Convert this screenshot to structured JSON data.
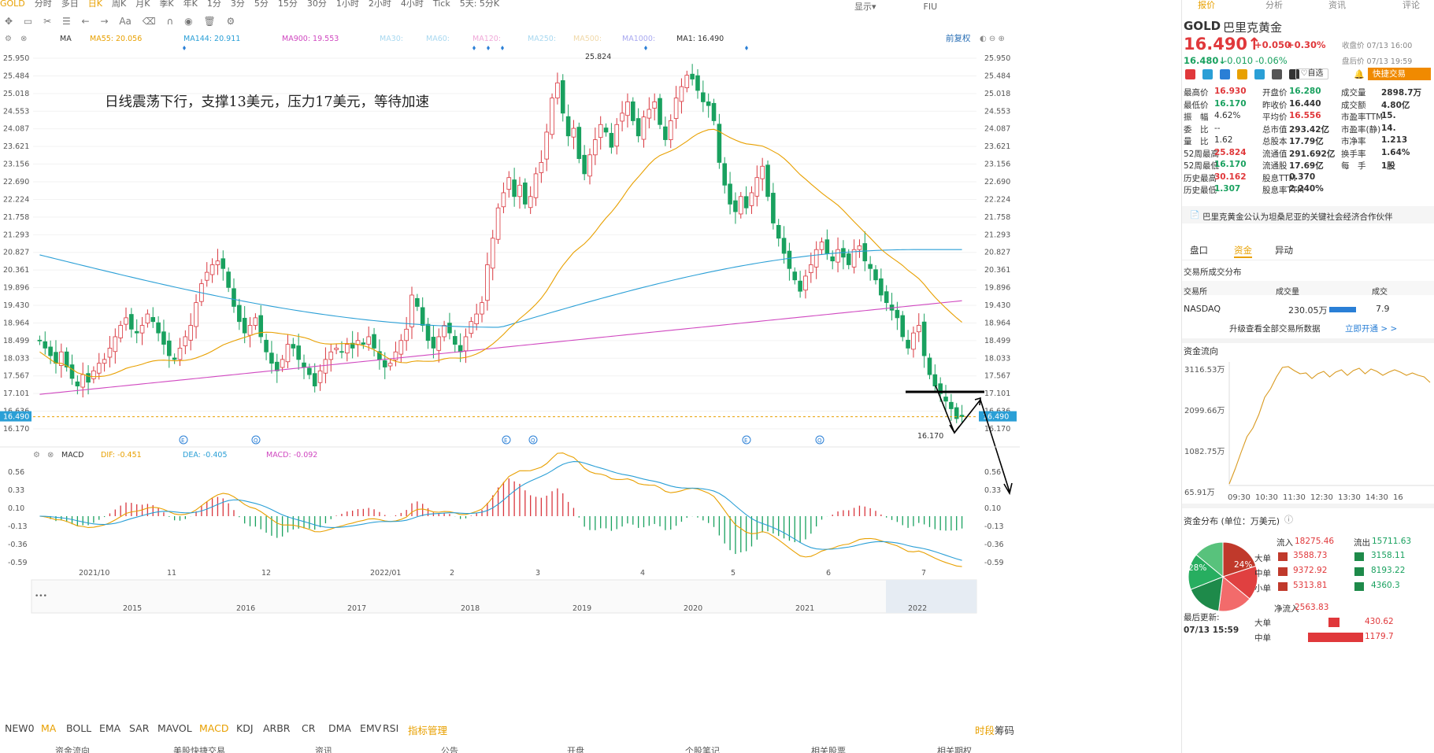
{
  "app": {
    "symbol_tab": "GOLD"
  },
  "topbar": [
    "GOLD",
    "分时",
    "多日",
    "日K",
    "周K",
    "月K",
    "季K",
    "年K",
    "1分",
    "3分",
    "5分",
    "15分",
    "30分",
    "1小时",
    "2小时",
    "4小时",
    "Tick",
    "5天: 5分K"
  ],
  "topbar_active": 3,
  "topbar_right": [
    "显示▾",
    "FIU"
  ],
  "annotation": "日线震荡下行，支撑13美元，压力17美元，等待加速",
  "ma_legend": [
    {
      "label": "MA",
      "color": "#333"
    },
    {
      "label": "MA55: 20.056",
      "color": "#e8a000"
    },
    {
      "label": "MA144: 20.911",
      "color": "#2a9fd6"
    },
    {
      "label": "MA900: 19.553",
      "color": "#d048c0"
    },
    {
      "label": "MA30:",
      "color": "#a8d8f0"
    },
    {
      "label": "MA60:",
      "color": "#a8d8f0"
    },
    {
      "label": "MA120:",
      "color": "#f0a8d8"
    },
    {
      "label": "MA250:",
      "color": "#a8d8f0"
    },
    {
      "label": "MA500:",
      "color": "#f0d8a8"
    },
    {
      "label": "MA1000:",
      "color": "#a8a8f0"
    },
    {
      "label": "MA1: 16.490",
      "color": "#333"
    }
  ],
  "fuquan": "前复权",
  "macd_legend": [
    {
      "label": "MACD",
      "color": "#333"
    },
    {
      "label": "DIF: -0.451",
      "color": "#e8a000"
    },
    {
      "label": "DEA: -0.405",
      "color": "#2a9fd6"
    },
    {
      "label": "MACD: -0.092",
      "color": "#d048c0"
    }
  ],
  "price_ticks": [
    "25.950",
    "25.484",
    "25.018",
    "24.553",
    "24.087",
    "23.621",
    "23.156",
    "22.690",
    "22.224",
    "21.758",
    "21.293",
    "20.827",
    "20.361",
    "19.896",
    "19.430",
    "18.964",
    "18.499",
    "18.033",
    "17.567",
    "17.101",
    "16.636",
    "16.170"
  ],
  "macd_ticks": [
    "0.56",
    "0.33",
    "0.10",
    "-0.13",
    "-0.36",
    "-0.59"
  ],
  "current_price_label": "16.490",
  "high_label": "25.824",
  "low_label": "16.170",
  "month_labels": [
    "2021/10",
    "11",
    "12",
    "2022/01",
    "2",
    "3",
    "4",
    "5",
    "6",
    "7"
  ],
  "year_labels": [
    "2015",
    "2016",
    "2017",
    "2018",
    "2019",
    "2020",
    "2021",
    "2022"
  ],
  "indicators": [
    "NEW0",
    "MA",
    "BOLL",
    "EMA",
    "SAR",
    "MAVOL",
    "MACD",
    "KDJ",
    "ARBR",
    "CR",
    "DMA",
    "EMV",
    "RSI",
    "指标管理"
  ],
  "indicators_active": [
    1,
    6
  ],
  "indicators_right": [
    "时段",
    "筹码"
  ],
  "bottom_tabs": [
    "资金流向",
    "美股快捷交易",
    "资讯",
    "公告",
    "开盘",
    "个股笔记",
    "相关股票",
    "相关期权"
  ],
  "right": {
    "tabs": [
      "报价",
      "分析",
      "资讯",
      "评论"
    ],
    "ticker": "GOLD",
    "name": "巴里克黄金",
    "price": "16.490↑",
    "change": "+0.050",
    "change_pct": "+0.30%",
    "close_note": "收盘价 07/13 16:00",
    "after_price": "16.480↓",
    "after_change": "-0.010",
    "after_pct": "-0.06%",
    "after_note": "盘后价 07/13 19:59",
    "watch": "自选",
    "fast_trade": "快捷交易",
    "stats": [
      [
        "最高价",
        "16.930",
        "red",
        "开盘价",
        "16.280",
        "green",
        "成交量",
        "2898.7万",
        ""
      ],
      [
        "最低价",
        "16.170",
        "green",
        "昨收价",
        "16.440",
        "",
        "成交额",
        "4.80亿",
        ""
      ],
      [
        "振　幅",
        "4.62%",
        "",
        "平均价",
        "16.556",
        "red",
        "市盈率TTM",
        "15.",
        ""
      ],
      [
        "委　比",
        "--",
        "",
        "总市值",
        "293.42亿",
        "",
        "市盈率(静)",
        "14.",
        ""
      ],
      [
        "量　比",
        "1.62",
        "",
        "总股本",
        "17.79亿",
        "",
        "市净率",
        "1.213",
        ""
      ],
      [
        "52周最高",
        "25.824",
        "red",
        "流通值",
        "291.692亿",
        "",
        "换手率",
        "1.64%",
        ""
      ],
      [
        "52周最低",
        "16.170",
        "green",
        "流通股",
        "17.69亿",
        "",
        "每　手",
        "1股",
        ""
      ],
      [
        "历史最高",
        "30.162",
        "red",
        "股息TTM",
        "0.370",
        "",
        "",
        "",
        ""
      ],
      [
        "历史最低",
        "1.307",
        "green",
        "股息率TTM",
        "2.240%",
        "",
        "",
        "",
        ""
      ]
    ],
    "news": "巴里克黄金公认为坦桑尼亚的关键社会经济合作伙伴",
    "sub_tabs": [
      "盘口",
      "资金",
      "异动"
    ],
    "exch_title": "交易所成交分布",
    "exch_head": [
      "交易所",
      "成交量",
      "成交"
    ],
    "exch_row": [
      "NASDAQ",
      "230.05万",
      "7.9"
    ],
    "upgrade": "升级查看全部交易所数据",
    "upgrade_link": "立即开通 > >",
    "flow_title": "资金流向",
    "flow_ticks": [
      "3116.53万",
      "2099.66万",
      "1082.75万",
      "65.91万"
    ],
    "flow_times": [
      "09:30",
      "10:30",
      "11:30",
      "12:30",
      "13:30",
      "14:30",
      "16"
    ],
    "dist_title": "资金分布 (单位：万美元)",
    "pie_in_pct": "28%",
    "pie_out_pct": "24%",
    "inflow_label": "流入",
    "inflow": "18275.46",
    "outflow_label": "流出",
    "outflow": "15711.63",
    "rows": [
      {
        "label": "大单",
        "in": "3588.73",
        "out": "3158.11"
      },
      {
        "label": "中单",
        "in": "9372.92",
        "out": "8193.22"
      },
      {
        "label": "小单",
        "in": "5313.81",
        "out": "4360.3"
      }
    ],
    "last_update_label": "最后更新:",
    "last_update": "07/13 15:59",
    "net_label": "净流入",
    "net": "2563.83",
    "net_rows": [
      {
        "label": "大单",
        "value": "430.62"
      },
      {
        "label": "中单",
        "value": "1179.7"
      }
    ]
  },
  "chart_data": {
    "type": "candlestick",
    "title": "GOLD 日K",
    "y_range": [
      16.17,
      25.95
    ],
    "macd_range": [
      -0.59,
      0.56
    ],
    "closes": [
      18.5,
      18.3,
      18.1,
      17.9,
      18.2,
      17.8,
      17.5,
      17.3,
      17.6,
      17.4,
      17.7,
      17.9,
      18.0,
      18.3,
      18.6,
      18.9,
      19.1,
      18.8,
      18.7,
      18.9,
      19.2,
      19.0,
      18.7,
      18.4,
      18.1,
      18.0,
      18.3,
      18.6,
      18.9,
      19.5,
      20.0,
      20.3,
      20.5,
      20.6,
      20.4,
      19.9,
      19.4,
      19.0,
      18.7,
      18.9,
      19.1,
      18.6,
      18.2,
      17.9,
      17.7,
      18.0,
      18.4,
      18.3,
      18.0,
      17.8,
      17.6,
      17.3,
      17.7,
      18.0,
      18.2,
      18.3,
      18.2,
      18.4,
      18.3,
      18.5,
      18.4,
      18.6,
      18.3,
      18.0,
      17.8,
      17.9,
      18.2,
      18.5,
      18.8,
      19.7,
      19.4,
      18.9,
      18.5,
      18.3,
      18.6,
      18.9,
      18.7,
      18.4,
      18.2,
      18.6,
      19.0,
      19.2,
      19.5,
      20.5,
      21.2,
      22.0,
      22.4,
      22.8,
      22.3,
      22.6,
      22.1,
      22.3,
      22.9,
      23.2,
      24.0,
      24.9,
      25.3,
      24.5,
      23.9,
      24.1,
      23.3,
      22.9,
      23.4,
      23.8,
      24.2,
      24.0,
      23.6,
      24.2,
      24.5,
      24.8,
      24.3,
      23.9,
      24.4,
      24.6,
      24.8,
      24.2,
      23.8,
      24.3,
      24.9,
      25.2,
      25.5,
      25.4,
      25.1,
      24.8,
      24.7,
      24.3,
      23.2,
      22.6,
      22.1,
      21.9,
      22.3,
      22.0,
      22.4,
      22.8,
      23.1,
      22.3,
      21.6,
      21.2,
      20.8,
      20.4,
      20.1,
      19.8,
      20.2,
      20.5,
      20.9,
      21.1,
      20.8,
      20.6,
      20.9,
      20.7,
      20.5,
      20.9,
      21.0,
      20.6,
      20.4,
      20.1,
      19.7,
      19.5,
      19.3,
      19.1,
      18.6,
      18.3,
      18.7,
      18.9,
      18.1,
      17.6,
      17.3,
      17.1,
      16.9,
      16.7,
      16.44,
      16.49
    ],
    "ma55_start": 19.0,
    "ma144_start": 20.76,
    "ma900_start": 17.08,
    "macd_hist_note": "MACD histogram derived from DIF-DEA"
  }
}
